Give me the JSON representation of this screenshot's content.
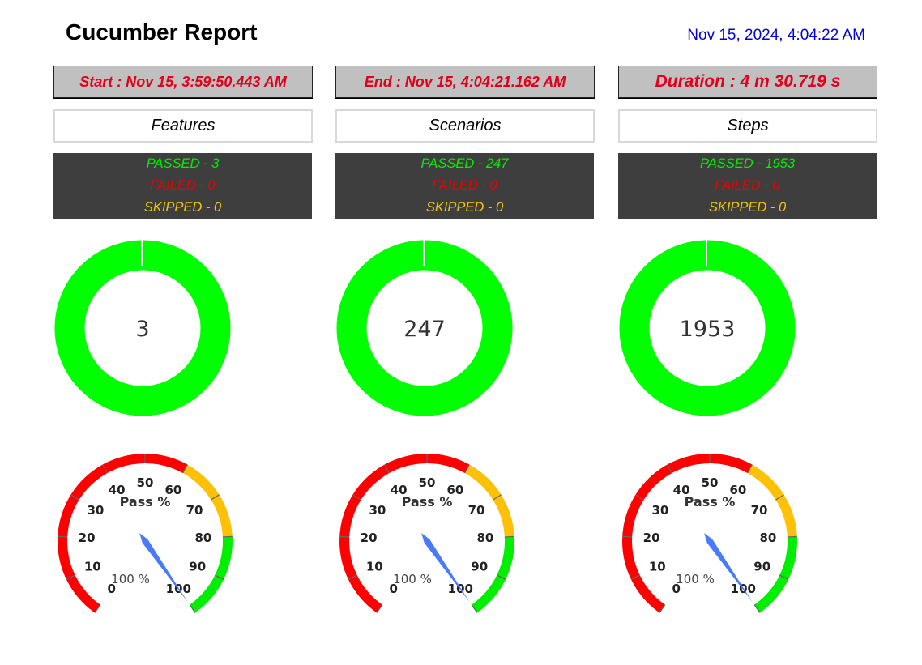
{
  "header": {
    "title": "Cucumber Report",
    "datetime": "Nov 15, 2024, 4:04:22 AM"
  },
  "times": {
    "start": "Start : Nov 15, 3:59:50.443 AM",
    "end": "End : Nov 15, 4:04:21.162 AM",
    "duration": "Duration : 4 m 30.719 s"
  },
  "sections": [
    {
      "category": "Features",
      "passed_label": "PASSED - 3",
      "failed_label": "FAILED - 0",
      "skipped_label": "SKIPPED - 0",
      "donut_total": "3",
      "gauge_value_label": "100 %"
    },
    {
      "category": "Scenarios",
      "passed_label": "PASSED - 247",
      "failed_label": "FAILED - 0",
      "skipped_label": "SKIPPED - 0",
      "donut_total": "247",
      "gauge_value_label": "100 %"
    },
    {
      "category": "Steps",
      "passed_label": "PASSED - 1953",
      "failed_label": "FAILED - 0",
      "skipped_label": "SKIPPED - 0",
      "donut_total": "1953",
      "gauge_value_label": "100 %"
    }
  ],
  "gauge": {
    "title": "Pass %",
    "ticks": [
      "0",
      "10",
      "20",
      "30",
      "40",
      "50",
      "60",
      "70",
      "80",
      "90",
      "100"
    ],
    "value": 100,
    "min": 0,
    "max": 100,
    "bands": [
      {
        "from": 0,
        "to": 60,
        "color": "#ff0000"
      },
      {
        "from": 60,
        "to": 80,
        "color": "#ffc107"
      },
      {
        "from": 80,
        "to": 100,
        "color": "#00ee00"
      }
    ]
  },
  "colors": {
    "passed": "#00ff00",
    "failed": "#ff0000",
    "skipped": "#ffc107",
    "needle": "#4a7bf7"
  }
}
